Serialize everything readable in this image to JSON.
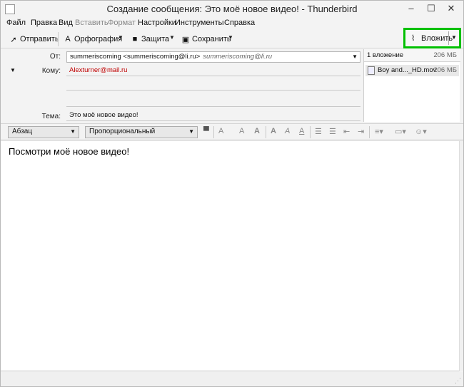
{
  "window": {
    "title": "Создание сообщения: Это моё новое видео! - Thunderbird",
    "minimize": "–",
    "maximize": "☐",
    "close": "✕"
  },
  "menu": {
    "items": [
      {
        "label": "Файл",
        "enabled": true
      },
      {
        "label": "Правка",
        "enabled": true
      },
      {
        "label": "Вид",
        "enabled": true
      },
      {
        "label": "Вставить",
        "enabled": false
      },
      {
        "label": "Формат",
        "enabled": false
      },
      {
        "label": "Настройки",
        "enabled": true
      },
      {
        "label": "Инструменты",
        "enabled": true
      },
      {
        "label": "Справка",
        "enabled": true
      }
    ]
  },
  "toolbar": {
    "send_label": "Отправить",
    "spell_label": "Орфография",
    "security_label": "Защита",
    "save_label": "Сохранить",
    "attach_label": "Вложить"
  },
  "headers": {
    "from_label": "От:",
    "from_value": "summeriscoming <summeriscoming@li.ru>",
    "from_alt": "summeriscoming@li.ru",
    "to_label": "Кому:",
    "to_value": "Alexturner@mail.ru",
    "subject_label": "Тема:",
    "subject_value": "Это моё новое видео!"
  },
  "attachments": {
    "count_label": "1 вложение",
    "total_size": "206 МБ",
    "items": [
      {
        "name": "Boy and..._HD.mov",
        "size": "206 МБ"
      }
    ]
  },
  "format": {
    "paragraph_style": "Абзац",
    "font": "Пропорциональный"
  },
  "editor": {
    "body": "Посмотри моё новое видео!"
  },
  "colors": {
    "highlight": "#00c000",
    "recipient": "#c00000"
  }
}
